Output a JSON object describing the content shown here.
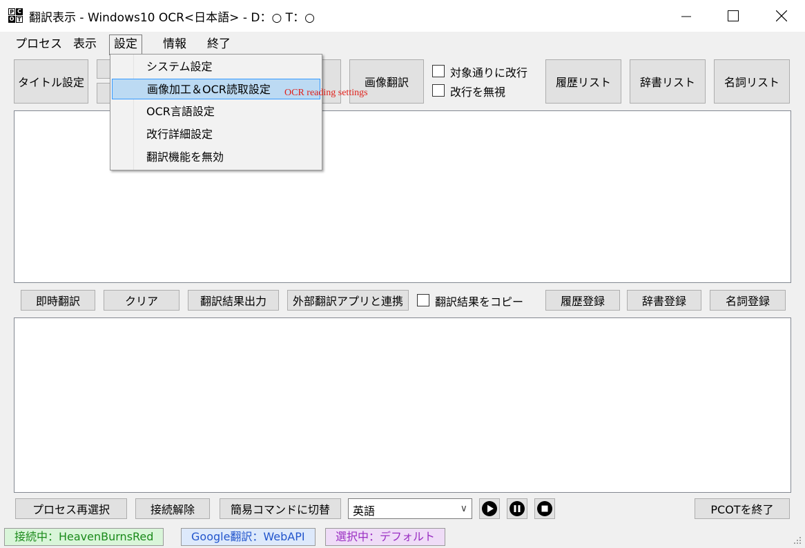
{
  "window": {
    "icon_letters": [
      "P",
      "C",
      "O",
      "T"
    ],
    "title": "翻訳表示 - Windows10 OCR<日本語> - D：○ T：○"
  },
  "menu": {
    "process": "プロセス",
    "view": "表示",
    "settings": "設定",
    "info": "情報",
    "exit": "終了"
  },
  "settings_menu": {
    "items": [
      "システム設定",
      "画像加工＆OCR読取設定",
      "OCR言語設定",
      "改行詳細設定",
      "翻訳機能を無効"
    ],
    "highlighted_index": 1,
    "tooltip": "OCR reading settings"
  },
  "toolbar": {
    "title_settings": "タイトル設定",
    "image_translate": "画像翻訳",
    "check_linebreak_as_target": "対象通りに改行",
    "check_ignore_linebreak": "改行を無視",
    "history_list": "履歴リスト",
    "dictionary_list": "辞書リスト",
    "noun_list": "名詞リスト"
  },
  "midbar": {
    "instant_translate": "即時翻訳",
    "clear": "クリア",
    "output_result": "翻訳結果出力",
    "external_app": "外部翻訳アプリと連携",
    "copy_result": "翻訳結果をコピー",
    "register_history": "履歴登録",
    "register_dictionary": "辞書登録",
    "register_noun": "名詞登録"
  },
  "bottombar": {
    "reselect_process": "プロセス再選択",
    "disconnect": "接続解除",
    "simple_command": "簡易コマンドに切替",
    "language": "英語",
    "exit_pcot": "PCOTを終了"
  },
  "statusbar": {
    "connection": "接続中：HeavenBurnsRed",
    "translator": "Google翻訳：WebAPI",
    "selection": "選択中：デフォルト",
    "connection_bg": "#d9f5d9",
    "connection_color": "#1a8a1a",
    "translator_bg": "#dde9fb",
    "translator_color": "#2255cc",
    "selection_bg": "#efdcf7",
    "selection_color": "#9a2ec2"
  }
}
